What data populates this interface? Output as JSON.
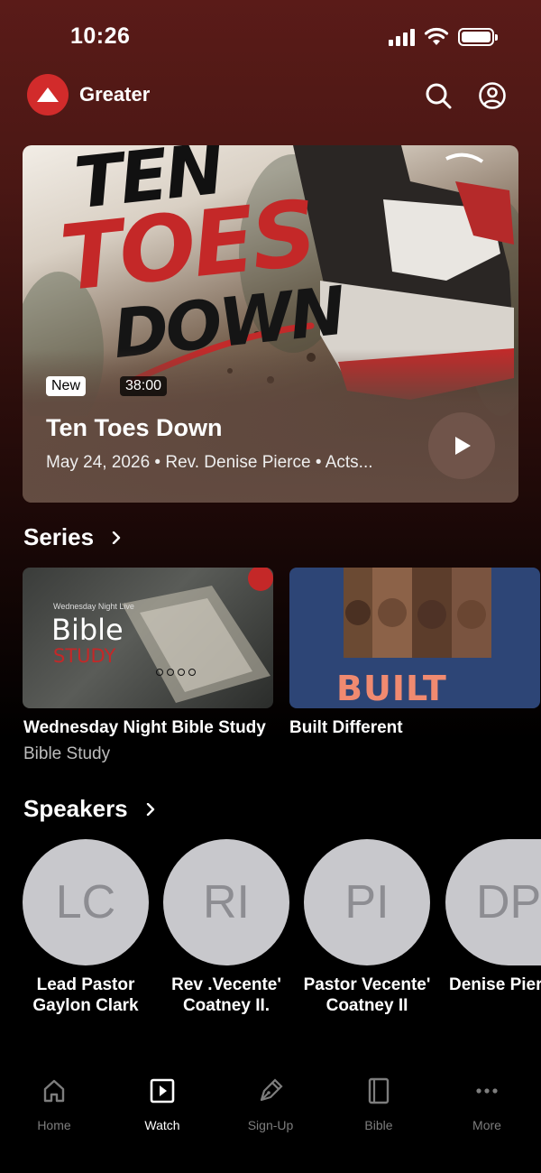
{
  "status_bar": {
    "time": "10:26"
  },
  "header": {
    "brand": "Greater"
  },
  "hero": {
    "art_lines": [
      "TEN",
      "TOES",
      "DOWN"
    ],
    "badge_new": "New",
    "duration": "38:00",
    "title": "Ten Toes Down",
    "meta": "May 24, 2026 • Rev. Denise Pierce • Acts..."
  },
  "series": {
    "heading": "Series",
    "items": [
      {
        "art_top": "Wednesday Night Live",
        "art_main": "Bible",
        "art_sub": "STUDY",
        "name": "Wednesday Night Bible Study",
        "subtitle": "Bible Study"
      },
      {
        "art_main": "BUILT",
        "name": "Built Different"
      }
    ]
  },
  "speakers": {
    "heading": "Speakers",
    "items": [
      {
        "initials": "LC",
        "name": "Lead Pastor Gaylon Clark"
      },
      {
        "initials": "RI",
        "name": "Rev .Vecente' Coatney II."
      },
      {
        "initials": "PI",
        "name": "Pastor Vecente' Coatney II"
      },
      {
        "initials": "DP",
        "name": "Denise Pierce"
      }
    ]
  },
  "tabs": [
    {
      "label": "Home",
      "icon": "home-icon",
      "active": false
    },
    {
      "label": "Watch",
      "icon": "play-square-icon",
      "active": true
    },
    {
      "label": "Sign-Up",
      "icon": "pen-icon",
      "active": false
    },
    {
      "label": "Bible",
      "icon": "book-icon",
      "active": false
    },
    {
      "label": "More",
      "icon": "more-icon",
      "active": false
    }
  ],
  "colors": {
    "accent": "#d22b2b",
    "avatar_bg": "#c8c8cc",
    "tab_inactive": "#7d7d7d"
  }
}
